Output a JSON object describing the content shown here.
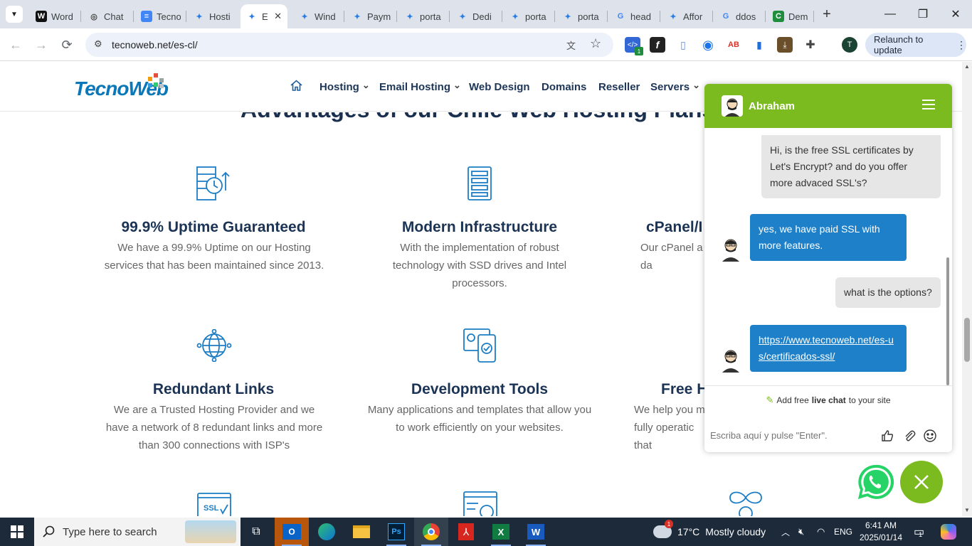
{
  "browser": {
    "tabs": [
      {
        "label": "Word",
        "fav": "W",
        "fav_bg": "#111",
        "fav_fg": "#fff"
      },
      {
        "label": "Chat",
        "fav": "◎",
        "fav_bg": "transparent",
        "fav_fg": "#444"
      },
      {
        "label": "Tecno",
        "fav": "≡",
        "fav_bg": "#4285f4",
        "fav_fg": "#fff"
      },
      {
        "label": "Hosti",
        "fav": "✦",
        "fav_bg": "transparent",
        "fav_fg": "#2a7de1"
      },
      {
        "label": "E",
        "fav": "✦",
        "fav_bg": "transparent",
        "fav_fg": "#2a7de1",
        "active": true
      },
      {
        "label": "Wind",
        "fav": "✦",
        "fav_bg": "transparent",
        "fav_fg": "#2a7de1"
      },
      {
        "label": "Paym",
        "fav": "✦",
        "fav_bg": "transparent",
        "fav_fg": "#2a7de1"
      },
      {
        "label": "porta",
        "fav": "✦",
        "fav_bg": "transparent",
        "fav_fg": "#2a7de1"
      },
      {
        "label": "Dedi",
        "fav": "✦",
        "fav_bg": "transparent",
        "fav_fg": "#2a7de1"
      },
      {
        "label": "porta",
        "fav": "✦",
        "fav_bg": "transparent",
        "fav_fg": "#2a7de1"
      },
      {
        "label": "porta",
        "fav": "✦",
        "fav_bg": "transparent",
        "fav_fg": "#2a7de1"
      },
      {
        "label": "head",
        "fav": "G",
        "fav_bg": "transparent",
        "fav_fg": "#4285f4"
      },
      {
        "label": "Affor",
        "fav": "✦",
        "fav_bg": "transparent",
        "fav_fg": "#2a7de1"
      },
      {
        "label": "ddos",
        "fav": "G",
        "fav_bg": "transparent",
        "fav_fg": "#4285f4"
      },
      {
        "label": "Dem",
        "fav": "C",
        "fav_bg": "#1e8e3e",
        "fav_fg": "#fff"
      }
    ],
    "url": "tecnoweb.net/es-cl/",
    "relaunch_label": "Relaunch to update",
    "profile_initial": "T",
    "ext_badge": "1"
  },
  "site": {
    "logo_text": "TecnoWeb",
    "nav": [
      {
        "label": "Hosting",
        "dropdown": true
      },
      {
        "label": "Email Hosting",
        "dropdown": true
      },
      {
        "label": "Web Design",
        "dropdown": false
      },
      {
        "label": "Domains",
        "dropdown": false
      },
      {
        "label": "Reseller",
        "dropdown": false
      },
      {
        "label": "Servers",
        "dropdown": true
      }
    ],
    "section_title": "Advantages of our Chile Web Hosting Plans",
    "features": [
      {
        "title": "99.9% Uptime Guaranteed",
        "desc": "We have a 99.9% Uptime on our Hosting services that has been maintained since 2013."
      },
      {
        "title": "Modern Infrastructure",
        "desc": "With the implementation of robust technology with SSD drives and Intel processors."
      },
      {
        "title": "cPanel/I",
        "desc": "Our cPanel a\nda"
      },
      {
        "title": "Redundant Links",
        "desc": "We are a Trusted Hosting Provider and we have a network of 8 redundant links and more than 300 connections with ISP's"
      },
      {
        "title": "Development Tools",
        "desc": "Many applications and templates that allow you to work efficiently on your websites."
      },
      {
        "title": "Free H",
        "desc": "We help you m\nfully operatic\nthat"
      }
    ]
  },
  "chat": {
    "agent_name": "Abraham",
    "messages": [
      {
        "from": "user",
        "text": "Hi, is the free SSL certificates by Let's Encrypt? and do you offer more advaced SSL's?"
      },
      {
        "from": "agent",
        "text": "yes, we have paid SSL with more features."
      },
      {
        "from": "user",
        "text": "what is the options?"
      },
      {
        "from": "agent",
        "text": "https://www.tecnoweb.net/es-us/certificados-ssl/",
        "link": true
      }
    ],
    "powered_pre": "Add free",
    "powered_bold": "live chat",
    "powered_post": "to your site",
    "input_placeholder": "Escriba aquí y pulse \"Enter\"."
  },
  "taskbar": {
    "search_placeholder": "Type here to search",
    "weather_temp": "17°C",
    "weather_desc": "Mostly cloudy",
    "language": "ENG",
    "time": "6:41 AM",
    "date": "2025/01/14",
    "notification_count": "1"
  },
  "colors": {
    "chat_green": "#7cbb1f",
    "chat_blue": "#1e80c8",
    "brand_blue": "#0a78b8",
    "heading_navy": "#1b3355"
  }
}
